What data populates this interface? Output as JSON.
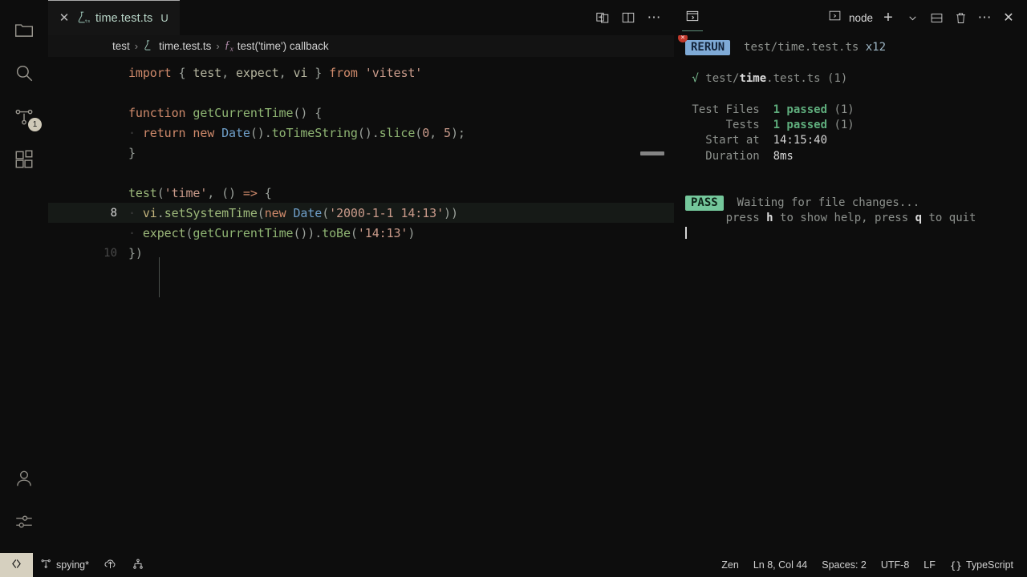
{
  "window": {
    "background": "#0d0d0d"
  },
  "activitybar": {
    "items": [
      {
        "name": "explorer",
        "icon": "folder-icon"
      },
      {
        "name": "search",
        "icon": "search-icon"
      },
      {
        "name": "source-control",
        "icon": "source-control-icon",
        "badge": "1"
      },
      {
        "name": "extensions",
        "icon": "extensions-icon"
      },
      {
        "name": "account",
        "icon": "account-icon"
      },
      {
        "name": "manage",
        "icon": "settings-sliders-icon"
      }
    ]
  },
  "tabs": {
    "active": {
      "close": "✕",
      "icon": "flask-ts-icon",
      "label": "time.test.ts",
      "dirty": "U"
    },
    "actions": [
      {
        "name": "split-editor-right-icon"
      },
      {
        "name": "split-editor-icon"
      },
      {
        "name": "more-actions-icon",
        "glyph": "⋯"
      }
    ]
  },
  "breadcrumbs": {
    "items": [
      {
        "label": "test",
        "icon": ""
      },
      {
        "label": "time.test.ts",
        "icon": "flask-ts-icon"
      },
      {
        "label": "test('time') callback",
        "icon": "fx-symbol-icon"
      }
    ],
    "separator": "›"
  },
  "editor": {
    "lines": [
      {
        "num": "",
        "active": false,
        "tokens": [
          {
            "t": "import ",
            "c": "t-kw"
          },
          {
            "t": "{ ",
            "c": "t-pun"
          },
          {
            "t": "test",
            "c": "t-imp"
          },
          {
            "t": ", ",
            "c": "t-pun"
          },
          {
            "t": "expect",
            "c": "t-imp"
          },
          {
            "t": ", ",
            "c": "t-pun"
          },
          {
            "t": "vi",
            "c": "t-imp"
          },
          {
            "t": " } ",
            "c": "t-pun"
          },
          {
            "t": "from ",
            "c": "t-kw"
          },
          {
            "t": "'vitest'",
            "c": "t-str"
          }
        ]
      },
      {
        "num": "",
        "active": false,
        "tokens": []
      },
      {
        "num": "",
        "active": false,
        "tokens": [
          {
            "t": "function ",
            "c": "t-kw"
          },
          {
            "t": "getCurrentTime",
            "c": "t-fn"
          },
          {
            "t": "() {",
            "c": "t-pun"
          }
        ]
      },
      {
        "num": "",
        "active": false,
        "tokens": [
          {
            "t": "· ",
            "c": "dot-ws"
          },
          {
            "t": "return ",
            "c": "t-kw"
          },
          {
            "t": "new ",
            "c": "t-kw"
          },
          {
            "t": "Date",
            "c": "t-cls"
          },
          {
            "t": "().",
            "c": "t-pun"
          },
          {
            "t": "toTimeString",
            "c": "t-prop"
          },
          {
            "t": "().",
            "c": "t-pun"
          },
          {
            "t": "slice",
            "c": "t-prop"
          },
          {
            "t": "(",
            "c": "t-pun"
          },
          {
            "t": "0",
            "c": "t-num"
          },
          {
            "t": ", ",
            "c": "t-pun"
          },
          {
            "t": "5",
            "c": "t-num"
          },
          {
            "t": ");",
            "c": "t-pun"
          }
        ]
      },
      {
        "num": "",
        "active": false,
        "tokens": [
          {
            "t": "}",
            "c": "t-pun"
          }
        ]
      },
      {
        "num": "",
        "active": false,
        "tokens": []
      },
      {
        "num": "",
        "active": false,
        "tokens": [
          {
            "t": "test",
            "c": "t-fn2"
          },
          {
            "t": "(",
            "c": "t-pun"
          },
          {
            "t": "'time'",
            "c": "t-str"
          },
          {
            "t": ", () ",
            "c": "t-pun"
          },
          {
            "t": "=>",
            "c": "t-kw"
          },
          {
            "t": " {",
            "c": "t-pun"
          }
        ]
      },
      {
        "num": "8",
        "active": true,
        "tokens": [
          {
            "t": "· ",
            "c": "dot-ws"
          },
          {
            "t": "vi",
            "c": "t-var"
          },
          {
            "t": ".",
            "c": "t-pun"
          },
          {
            "t": "setSystemTime",
            "c": "t-fn2"
          },
          {
            "t": "(",
            "c": "t-pun"
          },
          {
            "t": "new ",
            "c": "t-kw"
          },
          {
            "t": "Date",
            "c": "t-cls"
          },
          {
            "t": "(",
            "c": "t-pun"
          },
          {
            "t": "'2000-1-1 14:13'",
            "c": "t-str"
          },
          {
            "t": "))",
            "c": "t-pun"
          }
        ]
      },
      {
        "num": "",
        "active": false,
        "tokens": [
          {
            "t": "· ",
            "c": "dot-ws"
          },
          {
            "t": "expect",
            "c": "t-fn2"
          },
          {
            "t": "(",
            "c": "t-pun"
          },
          {
            "t": "getCurrentTime",
            "c": "t-fn"
          },
          {
            "t": "()).",
            "c": "t-pun"
          },
          {
            "t": "toBe",
            "c": "t-prop"
          },
          {
            "t": "(",
            "c": "t-pun"
          },
          {
            "t": "'14:13'",
            "c": "t-str"
          },
          {
            "t": ")",
            "c": "t-pun"
          }
        ]
      },
      {
        "num": "10",
        "active": false,
        "tokens": [
          {
            "t": "})",
            "c": "t-pun"
          }
        ]
      }
    ]
  },
  "panel": {
    "tab_icon": "terminal-icon",
    "actions": {
      "shell_icon": "terminal-dropdown-icon",
      "shell_label": "node",
      "new_terminal": "+",
      "chevron": "⌄",
      "split": "split-terminal-icon",
      "kill": "trash-icon",
      "more": "⋯",
      "close": "✕"
    },
    "terminal": {
      "error_badge": "✕",
      "lines": [
        {
          "parts": [
            {
              "t": "RERUN",
              "c": "badge b-rerun"
            },
            {
              "t": "  test/time.test.ts ",
              "c": "g-dim"
            },
            {
              "t": "x12",
              "c": "g-cyan"
            }
          ]
        },
        {
          "parts": []
        },
        {
          "parts": [
            {
              "t": " √ ",
              "c": "g-check"
            },
            {
              "t": "test/",
              "c": "g-dim"
            },
            {
              "t": "time",
              "c": "g-bold"
            },
            {
              "t": ".test.ts (1)",
              "c": "g-dim"
            }
          ]
        },
        {
          "parts": []
        },
        {
          "parts": [
            {
              "t": " Test Files  ",
              "c": "g-dim"
            },
            {
              "t": "1 passed",
              "c": "g-green"
            },
            {
              "t": " (1)",
              "c": "g-dim"
            }
          ]
        },
        {
          "parts": [
            {
              "t": "      Tests  ",
              "c": "g-dim"
            },
            {
              "t": "1 passed",
              "c": "g-green"
            },
            {
              "t": " (1)",
              "c": "g-dim"
            }
          ]
        },
        {
          "parts": [
            {
              "t": "   Start at  ",
              "c": "g-dim"
            },
            {
              "t": "14:15:40",
              "c": "g-white"
            }
          ]
        },
        {
          "parts": [
            {
              "t": "   Duration  ",
              "c": "g-dim"
            },
            {
              "t": "8ms",
              "c": "g-white"
            }
          ]
        },
        {
          "parts": []
        },
        {
          "parts": []
        },
        {
          "parts": [
            {
              "t": "PASS",
              "c": "badge b-pass"
            },
            {
              "t": "  Waiting for file changes...",
              "c": "g-dim"
            }
          ]
        },
        {
          "parts": [
            {
              "t": "      press ",
              "c": "g-dim"
            },
            {
              "t": "h",
              "c": "g-bold"
            },
            {
              "t": " to show help, press ",
              "c": "g-dim"
            },
            {
              "t": "q",
              "c": "g-bold"
            },
            {
              "t": " to quit",
              "c": "g-dim"
            }
          ]
        }
      ]
    }
  },
  "statusbar": {
    "remote": {
      "icon": "remote-window-icon",
      "label": ""
    },
    "left": [
      {
        "name": "branch",
        "icon": "source-control-icon",
        "label": "spying*"
      },
      {
        "name": "sync",
        "icon": "cloud-upload-icon",
        "label": ""
      },
      {
        "name": "ports",
        "icon": "ports-icon",
        "label": ""
      }
    ],
    "right": [
      {
        "name": "zen-mode",
        "label": "Zen"
      },
      {
        "name": "cursor-position",
        "label": "Ln 8, Col 44"
      },
      {
        "name": "indentation",
        "label": "Spaces: 2"
      },
      {
        "name": "encoding",
        "label": "UTF-8"
      },
      {
        "name": "eol",
        "label": "LF"
      },
      {
        "name": "language-mode",
        "label": "TypeScript",
        "icon": "braces-icon"
      }
    ]
  },
  "colors": {
    "background": "#0d0d0d",
    "rerun_badge": "#7faad6",
    "pass_badge": "#74c79b",
    "remote_indicator": "#d6d0bf",
    "accent_green": "#5fae7d",
    "error_red": "#c0392b"
  }
}
